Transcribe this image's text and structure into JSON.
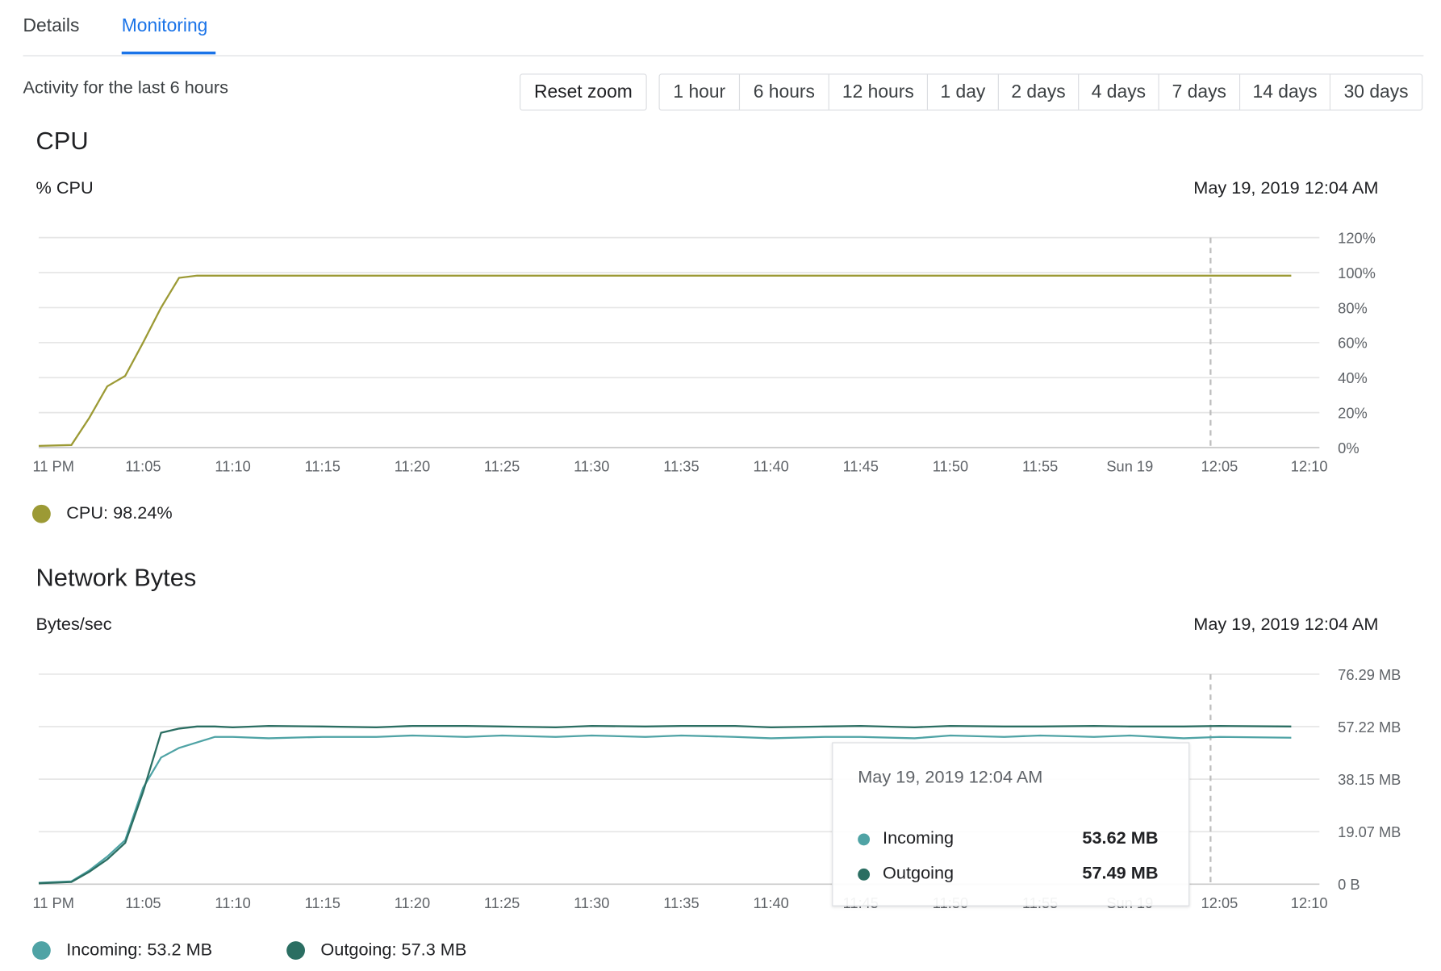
{
  "tabs": [
    {
      "label": "Details",
      "active": false
    },
    {
      "label": "Monitoring",
      "active": true
    }
  ],
  "activity_text": "Activity for the last 6 hours",
  "reset_zoom_label": "Reset zoom",
  "time_ranges": [
    "1 hour",
    "6 hours",
    "12 hours",
    "1 day",
    "2 days",
    "4 days",
    "7 days",
    "14 days",
    "30 days"
  ],
  "colors": {
    "accent": "#1a73e8",
    "cpu": "#9c9a35",
    "incoming": "#4fa3a5",
    "outgoing": "#2b6e62"
  },
  "cpu": {
    "title": "CPU",
    "unit": "% CPU",
    "timestamp": "May 19, 2019 12:04 AM",
    "legend": "CPU: 98.24%"
  },
  "network": {
    "title": "Network Bytes",
    "unit": "Bytes/sec",
    "timestamp": "May 19, 2019 12:04 AM",
    "legend_incoming": "Incoming: 53.2 MB",
    "legend_outgoing": "Outgoing: 57.3 MB",
    "tooltip": {
      "date": "May 19, 2019 12:04 AM",
      "incoming_label": "Incoming",
      "incoming_value": "53.62 MB",
      "outgoing_label": "Outgoing",
      "outgoing_value": "57.49 MB"
    }
  },
  "chart_data": [
    {
      "type": "line",
      "title": "CPU",
      "ylabel": "% CPU",
      "ylim": [
        0,
        120
      ],
      "y_ticks": [
        "0%",
        "20%",
        "40%",
        "60%",
        "80%",
        "100%",
        "120%"
      ],
      "x_ticks": [
        "11 PM",
        "11:05",
        "11:10",
        "11:15",
        "11:20",
        "11:25",
        "11:30",
        "11:35",
        "11:40",
        "11:45",
        "11:50",
        "11:55",
        "Sun 19",
        "12:05",
        "12:10"
      ],
      "x_minutes": [
        0,
        1,
        2,
        3,
        4,
        5,
        6,
        7,
        8,
        10,
        15,
        20,
        25,
        30,
        35,
        40,
        45,
        50,
        55,
        60,
        65,
        69
      ],
      "series": [
        {
          "name": "CPU",
          "values": [
            1,
            1.5,
            17,
            35,
            41,
            60,
            80,
            97,
            98.24,
            98.24,
            98.24,
            98.24,
            98.24,
            98.24,
            98.24,
            98.24,
            98.24,
            98.24,
            98.24,
            98.24,
            98.24,
            98.24
          ]
        }
      ],
      "cursor_minute": 64.5,
      "grid": true
    },
    {
      "type": "line",
      "title": "Network Bytes",
      "ylabel": "Bytes/sec",
      "ylim": [
        0,
        76.29
      ],
      "y_ticks": [
        "0 B",
        "19.07 MB",
        "38.15 MB",
        "57.22 MB",
        "76.29 MB"
      ],
      "x_ticks": [
        "11 PM",
        "11:05",
        "11:10",
        "11:15",
        "11:20",
        "11:25",
        "11:30",
        "11:35",
        "11:40",
        "11:45",
        "11:50",
        "11:55",
        "Sun 19",
        "12:05",
        "12:10"
      ],
      "x_minutes": [
        0,
        1,
        2,
        3,
        4,
        5,
        6,
        7,
        8,
        9,
        10,
        12,
        15,
        18,
        20,
        23,
        25,
        28,
        30,
        33,
        35,
        38,
        40,
        43,
        45,
        48,
        50,
        53,
        55,
        58,
        60,
        63,
        65,
        69
      ],
      "series": [
        {
          "name": "Incoming",
          "values": [
            0.5,
            1,
            5,
            10,
            16,
            35,
            46,
            49.5,
            51.5,
            53.5,
            53.5,
            53,
            53.5,
            53.5,
            54,
            53.5,
            54,
            53.5,
            54,
            53.5,
            54,
            53.5,
            53,
            53.5,
            53.5,
            53,
            54,
            53.5,
            54,
            53.5,
            54,
            53,
            53.5,
            53.2
          ]
        },
        {
          "name": "Outgoing",
          "values": [
            0.3,
            0.8,
            4.5,
            9,
            15,
            33.5,
            55,
            56.5,
            57.3,
            57.3,
            57,
            57.5,
            57.3,
            57,
            57.5,
            57.5,
            57.3,
            57,
            57.5,
            57.3,
            57.5,
            57.5,
            57,
            57.3,
            57.5,
            57,
            57.5,
            57.3,
            57.3,
            57.5,
            57.3,
            57.3,
            57.49,
            57.3
          ]
        }
      ],
      "cursor_minute": 64.5,
      "grid": true
    }
  ]
}
